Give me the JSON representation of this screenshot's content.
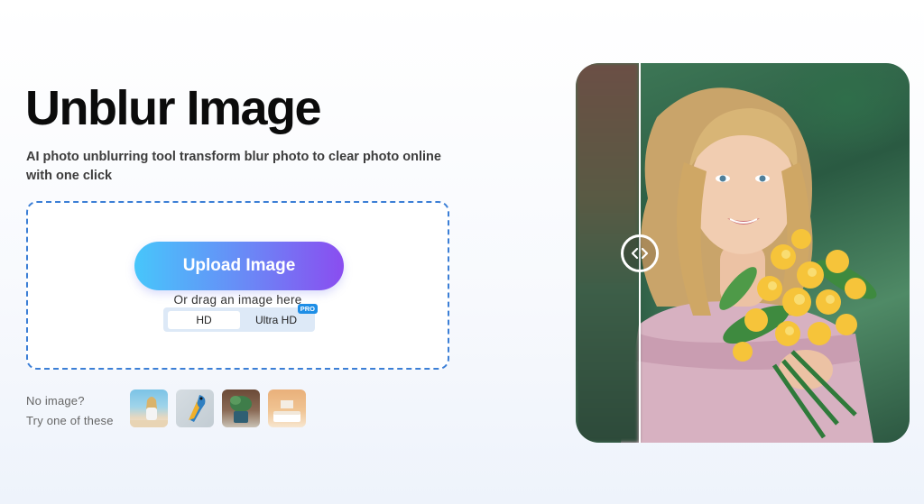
{
  "hero": {
    "title": "Unblur Image",
    "subtitle": "AI photo unblurring tool transform blur photo to clear photo online with one click"
  },
  "upload": {
    "button_label": "Upload Image",
    "drag_text": "Or drag an image here",
    "quality_options": [
      "HD",
      "Ultra HD"
    ],
    "selected_quality": "HD",
    "pro_badge": "PRO"
  },
  "samples": {
    "prompt_line1": "No image?",
    "prompt_line2": "Try one of these",
    "thumbnails": [
      "woman-beach-thumb",
      "parrot-thumb",
      "plant-pot-thumb",
      "bedroom-thumb"
    ]
  },
  "colors": {
    "button_gradient_start": "#47c6fb",
    "button_gradient_end": "#8a4df0",
    "dropzone_border": "#3c7fd6",
    "pro_badge": "#1e8ee6"
  },
  "icons": {
    "compare_handle": "chevrons-left-right-icon"
  }
}
